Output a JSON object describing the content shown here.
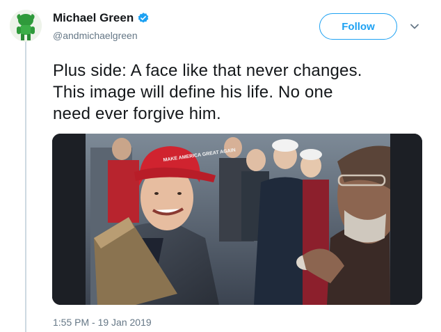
{
  "user": {
    "name": "Michael Green",
    "handle": "@andmichaelgreen",
    "verified": true
  },
  "actions": {
    "follow_label": "Follow"
  },
  "tweet": {
    "text_lines": [
      "Plus side: A face like that never changes.",
      "This image will define his life. No one",
      "need ever forgive him."
    ],
    "timestamp": "1:55 PM - 19 Jan 2019"
  },
  "media": {
    "hat_text": "MAKE AMERICA GREAT AGAIN"
  },
  "colors": {
    "accent": "#1da1f2",
    "text": "#14171a",
    "secondary": "#657786",
    "thread_line": "#cdd9e1"
  }
}
